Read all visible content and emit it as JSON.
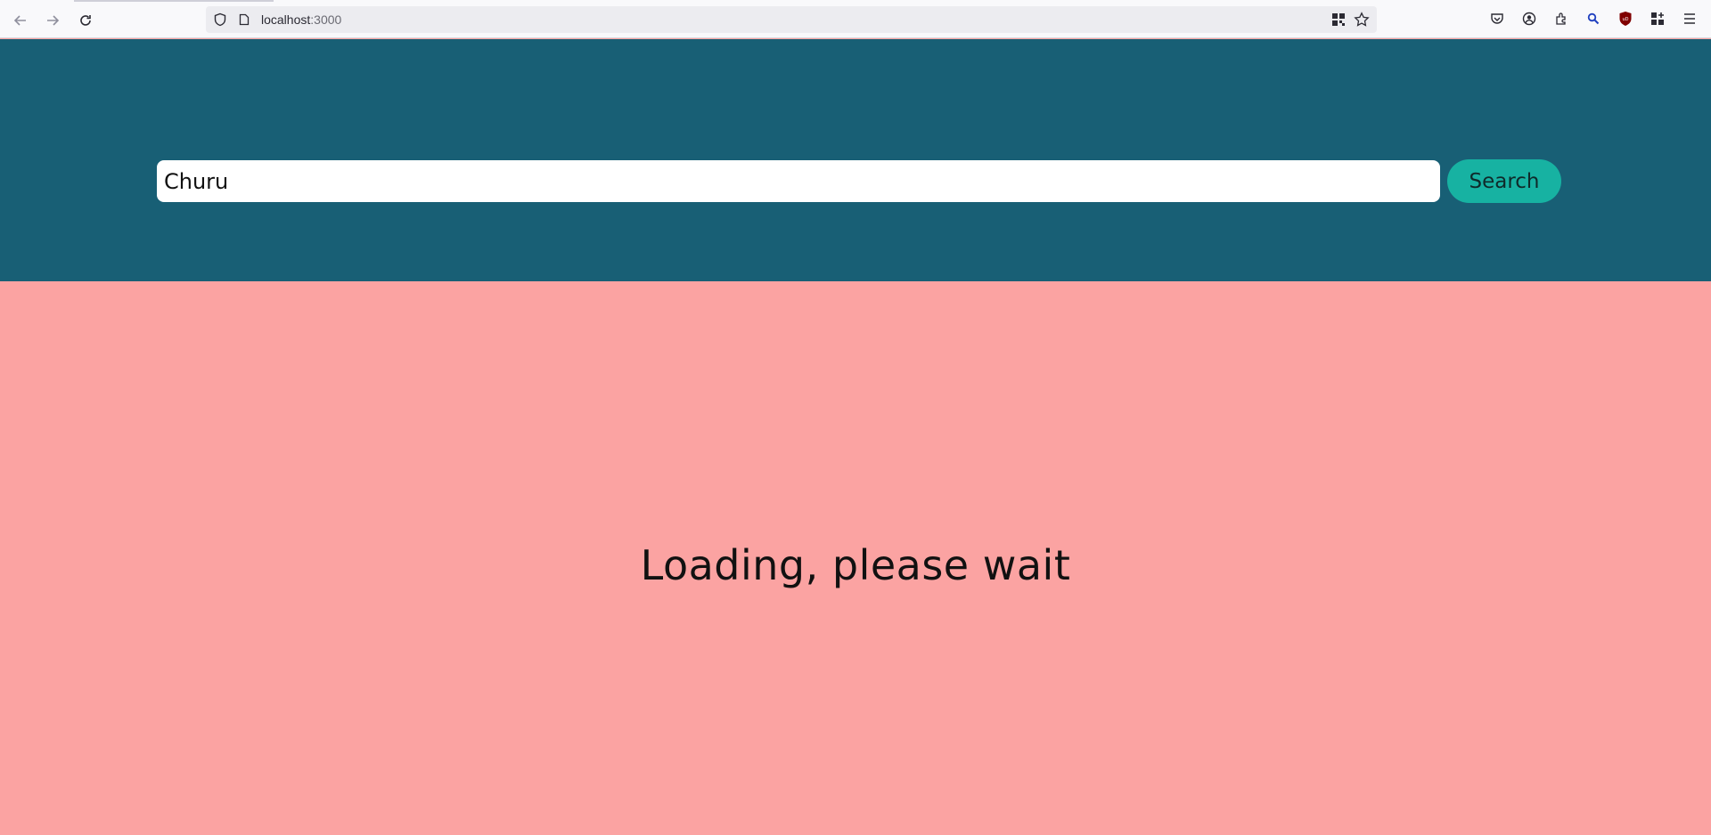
{
  "browser": {
    "url_host": "localhost",
    "url_port": ":3000"
  },
  "search": {
    "value": "Churu",
    "button_label": "Search"
  },
  "status": {
    "message": "Loading, please wait"
  },
  "colors": {
    "header_bg": "#185f75",
    "main_bg": "#fba3a2",
    "button_bg": "#17b2a2"
  }
}
